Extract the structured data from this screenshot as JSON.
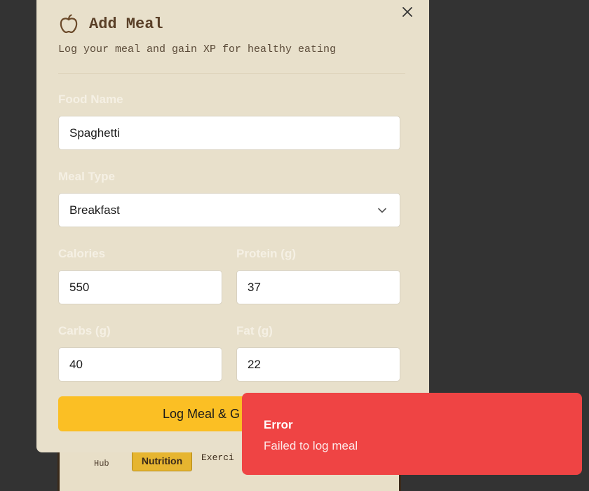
{
  "background_page": {
    "nav": {
      "hub_label": "Hub",
      "nutrition_label": "Nutrition",
      "exercise_label": "Exerci"
    }
  },
  "modal": {
    "title": "Add Meal",
    "subtitle": "Log your meal and gain XP for healthy eating",
    "close_icon": "close-icon",
    "title_icon": "apple-icon",
    "fields": {
      "food_name": {
        "label": "Food Name",
        "value": "Spaghetti"
      },
      "meal_type": {
        "label": "Meal Type",
        "value": "Breakfast"
      },
      "calories": {
        "label": "Calories",
        "value": "550"
      },
      "protein": {
        "label": "Protein (g)",
        "value": "37"
      },
      "carbs": {
        "label": "Carbs (g)",
        "value": "40"
      },
      "fat": {
        "label": "Fat (g)",
        "value": "22"
      }
    },
    "submit_label": "Log Meal & G"
  },
  "toast": {
    "title": "Error",
    "message": "Failed to log meal",
    "color": "#ef4444"
  },
  "colors": {
    "modal_bg": "#e8e0cb",
    "accent": "#fbbf24",
    "backdrop": "#333333"
  }
}
